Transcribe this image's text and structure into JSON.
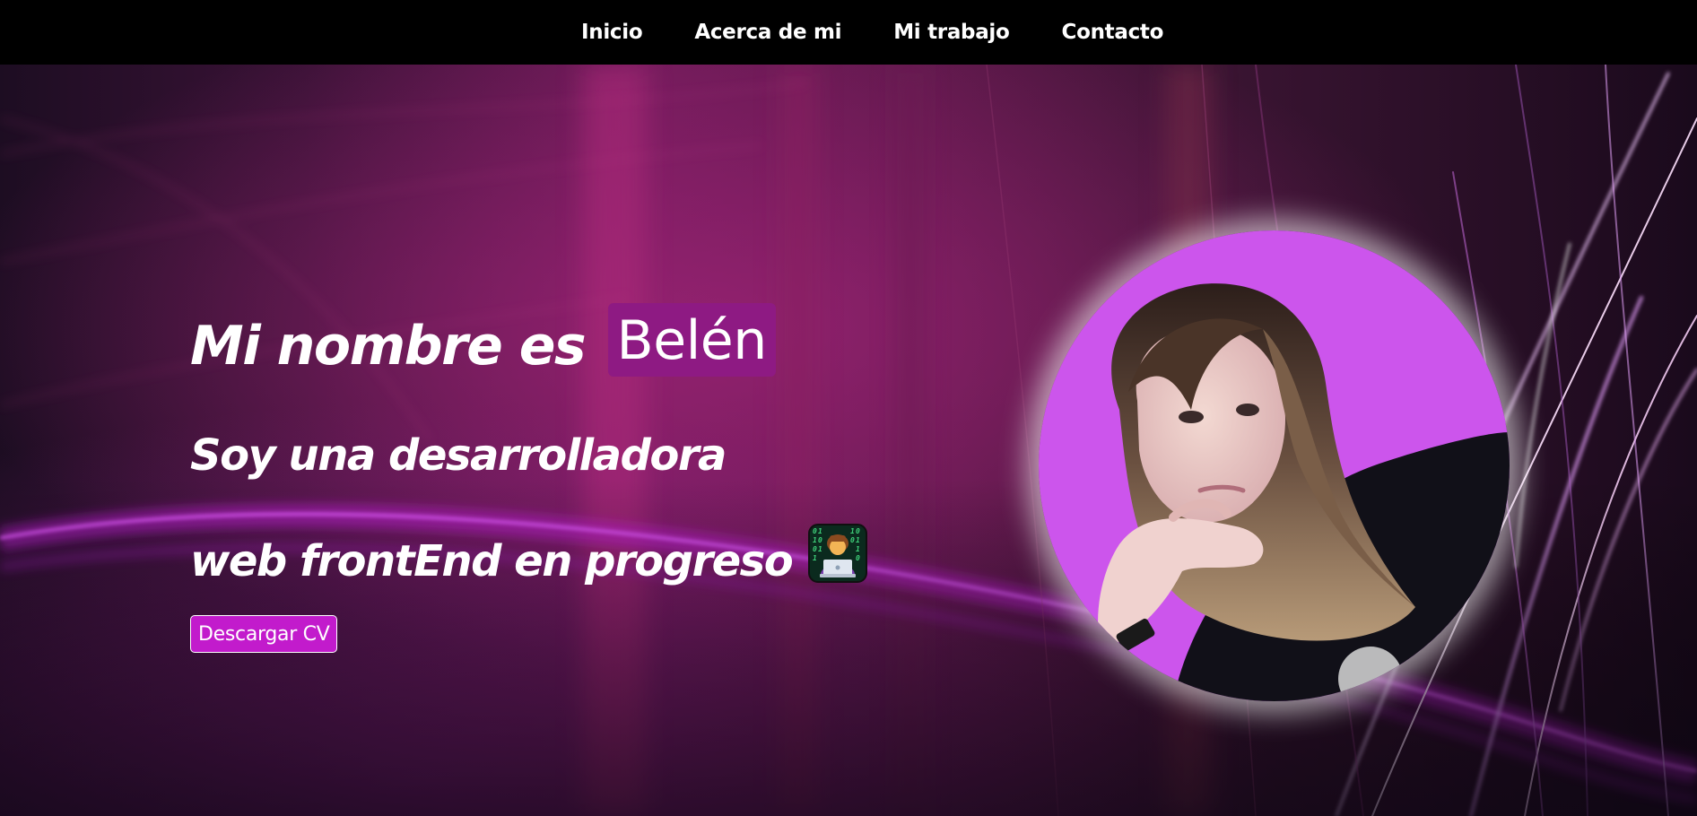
{
  "nav": {
    "items": [
      {
        "label": "Inicio"
      },
      {
        "label": "Acerca de mi"
      },
      {
        "label": "Mi trabajo"
      },
      {
        "label": "Contacto"
      }
    ]
  },
  "hero": {
    "title_prefix": "Mi nombre es",
    "name": "Belén",
    "subtitle_line1": "Soy una desarrolladora",
    "subtitle_line2": "web frontEnd en progreso",
    "emoji_icon": "technologist-icon",
    "cv_button_label": "Descargar CV",
    "avatar_icon": "profile-photo"
  },
  "colors": {
    "navbar_bg": "#000000",
    "name_badge_bg": "#8e1a83",
    "cv_button_bg": "#c21bcc",
    "avatar_bg": "#cc55ec"
  }
}
